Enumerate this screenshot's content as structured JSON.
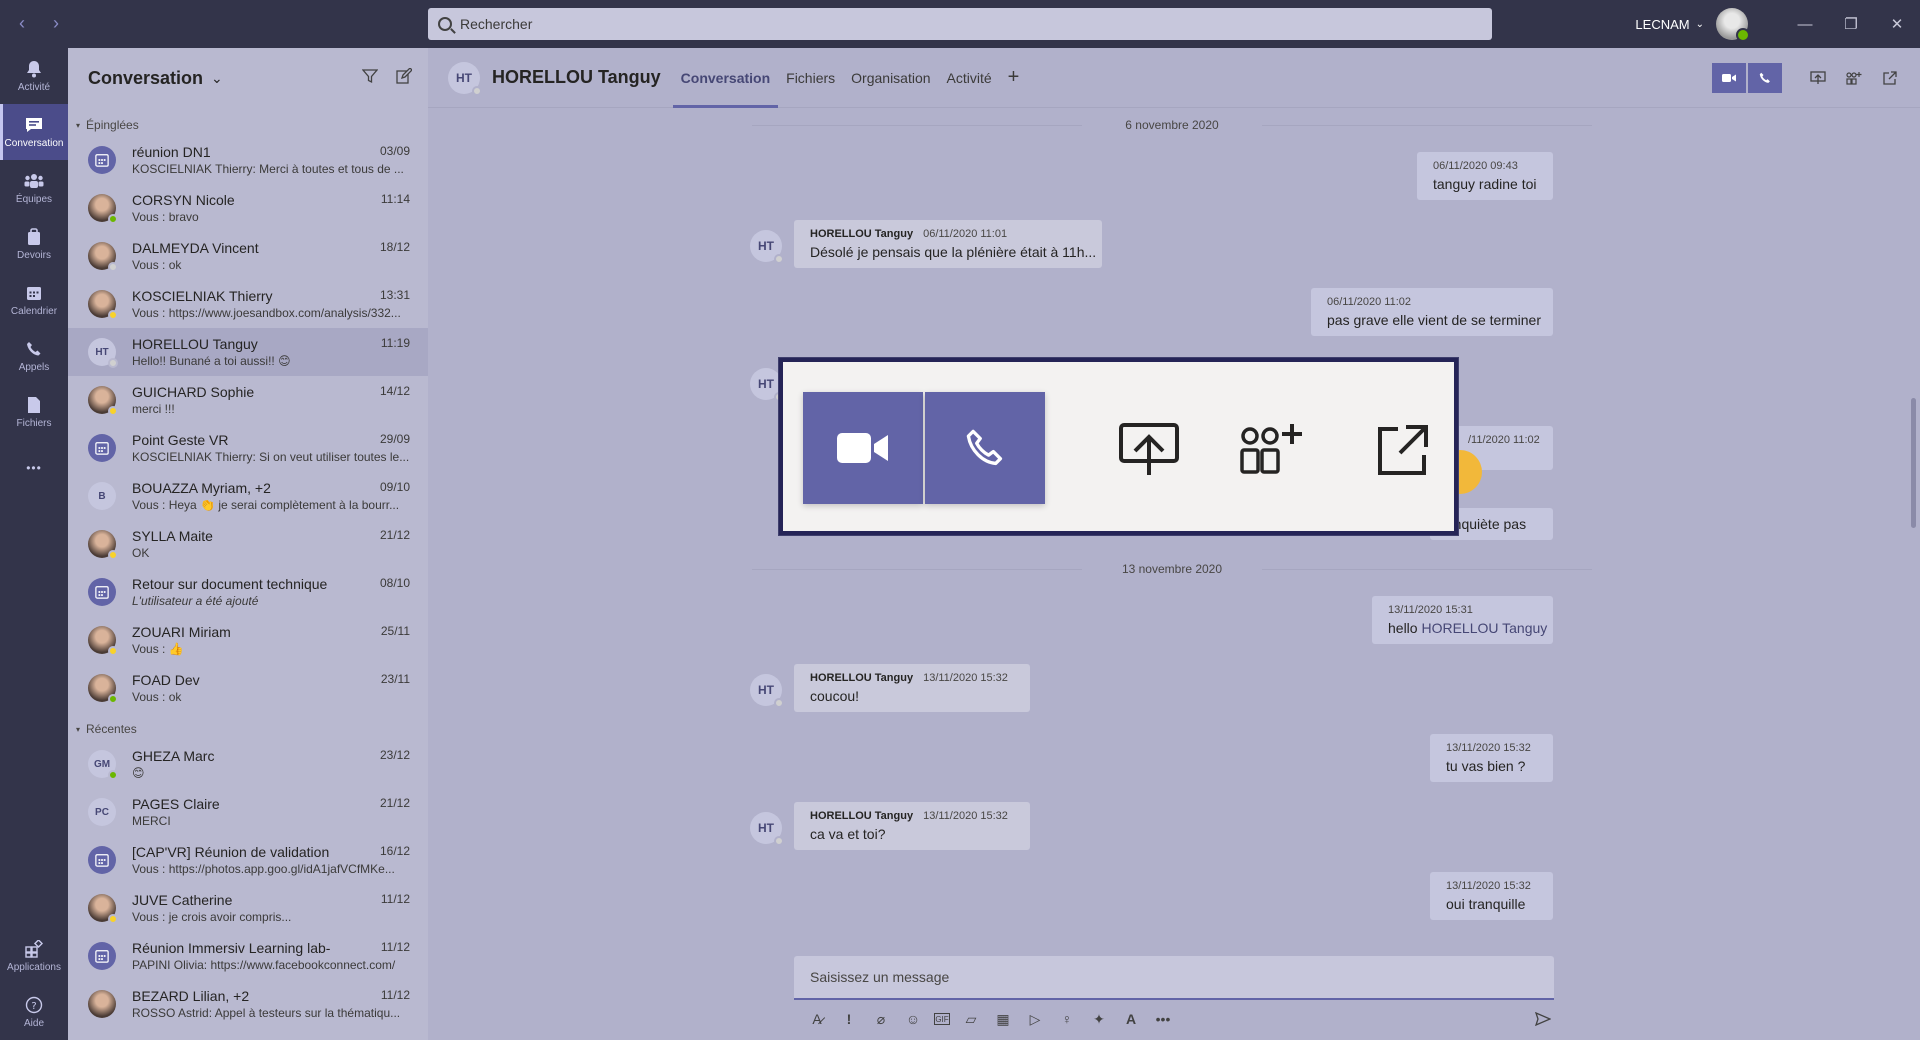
{
  "titlebar": {
    "back_icon": "chevron-left-icon",
    "forward_icon": "chevron-right-icon",
    "search_placeholder": "Rechercher",
    "tenant": "LECNAM",
    "minimize": "—",
    "restore": "❐",
    "close": "✕"
  },
  "rail": {
    "items": [
      {
        "label": "Activité",
        "icon": "bell-icon"
      },
      {
        "label": "Conversation",
        "icon": "chat-icon"
      },
      {
        "label": "Équipes",
        "icon": "teams-icon"
      },
      {
        "label": "Devoirs",
        "icon": "assignments-icon"
      },
      {
        "label": "Calendrier",
        "icon": "calendar-icon"
      },
      {
        "label": "Appels",
        "icon": "phone-icon"
      },
      {
        "label": "Fichiers",
        "icon": "files-icon"
      },
      {
        "label": "•••",
        "icon": "more-icon"
      }
    ],
    "bottom": [
      {
        "label": "Applications",
        "icon": "apps-icon"
      },
      {
        "label": "Aide",
        "icon": "help-icon"
      }
    ]
  },
  "list": {
    "title": "Conversation",
    "pinned_label": "Épinglées",
    "recent_label": "Récentes",
    "pinned": [
      {
        "name": "réunion DN1",
        "preview": "KOSCIELNIAK Thierry: Merci à toutes et tous de ...",
        "date": "03/09",
        "avatar": "meet"
      },
      {
        "name": "CORSYN Nicole",
        "preview": "Vous : bravo",
        "date": "11:14",
        "avatar": "photo",
        "status": "green"
      },
      {
        "name": "DALMEYDA Vincent",
        "preview": "Vous : ok",
        "date": "18/12",
        "avatar": "photo",
        "status": "gray"
      },
      {
        "name": "KOSCIELNIAK Thierry",
        "preview": "Vous : https://www.joesandbox.com/analysis/332...",
        "date": "13:31",
        "avatar": "photo",
        "status": "yellow"
      },
      {
        "name": "HORELLOU Tanguy",
        "preview": "Hello!! Bunané a toi aussi!! 😊",
        "date": "11:19",
        "avatar": "init",
        "initials": "HT",
        "status": "gray",
        "selected": true
      },
      {
        "name": "GUICHARD Sophie",
        "preview": "merci !!!",
        "date": "14/12",
        "avatar": "photo",
        "status": "yellow"
      },
      {
        "name": "Point Geste VR",
        "preview": "KOSCIELNIAK Thierry: Si on veut utiliser toutes le...",
        "date": "29/09",
        "avatar": "meet"
      },
      {
        "name": "BOUAZZA Myriam, +2",
        "preview": "Vous : Heya 👏 je serai complètement à la bourr...",
        "date": "09/10",
        "avatar": "init",
        "initials": "B"
      },
      {
        "name": "SYLLA Maite",
        "preview": "OK",
        "date": "21/12",
        "avatar": "photo",
        "status": "yellow"
      },
      {
        "name": "Retour sur document technique",
        "preview": "L'utilisateur a été ajouté",
        "date": "08/10",
        "avatar": "meet",
        "italic": true
      },
      {
        "name": "ZOUARI Miriam",
        "preview": "Vous : 👍",
        "date": "25/11",
        "avatar": "photo",
        "status": "yellow"
      },
      {
        "name": "FOAD Dev",
        "preview": "Vous : ok",
        "date": "23/11",
        "avatar": "photo",
        "status": "green"
      }
    ],
    "recent": [
      {
        "name": "GHEZA Marc",
        "preview": "😊",
        "date": "23/12",
        "avatar": "init",
        "initials": "GM",
        "status": "green"
      },
      {
        "name": "PAGES Claire",
        "preview": "MERCI",
        "date": "21/12",
        "avatar": "init",
        "initials": "PC"
      },
      {
        "name": "[CAP'VR] Réunion de validation",
        "preview": "Vous : https://photos.app.goo.gl/idA1jafVCfMKe...",
        "date": "16/12",
        "avatar": "meet"
      },
      {
        "name": "JUVE Catherine",
        "preview": "Vous : je crois avoir compris...",
        "date": "11/12",
        "avatar": "photo",
        "status": "yellow"
      },
      {
        "name": "Réunion Immersiv Learning lab-",
        "preview": "PAPINI Olivia: https://www.facebookconnect.com/",
        "date": "11/12",
        "avatar": "meet"
      },
      {
        "name": "BEZARD Lilian, +2",
        "preview": "ROSSO Astrid: Appel à testeurs sur la thématiqu...",
        "date": "11/12",
        "avatar": "photo"
      }
    ]
  },
  "chat": {
    "initials": "HT",
    "name": "HORELLOU Tanguy",
    "tabs": [
      "Conversation",
      "Fichiers",
      "Organisation",
      "Activité"
    ],
    "tab_add": "+",
    "date_sep_1": "6 novembre 2020",
    "date_sep_2": "13 novembre 2020",
    "messages": {
      "m1": {
        "time": "06/11/2020 09:43",
        "text": "tanguy radine toi"
      },
      "m2": {
        "author": "HORELLOU Tanguy",
        "time": "06/11/2020 11:01",
        "text": "Désolé je pensais que la plénière était à 11h..."
      },
      "m3": {
        "time": "06/11/2020 11:02",
        "text": "pas grave elle vient de se terminer"
      },
      "m4": {
        "time": "/11/2020 11:02"
      },
      "m5": {
        "text": "t'inquiète pas"
      },
      "m6": {
        "time": "13/11/2020 15:31",
        "text_prefix": "hello ",
        "mention": "HORELLOU Tanguy"
      },
      "m7": {
        "author": "HORELLOU Tanguy",
        "time": "13/11/2020 15:32",
        "text": "coucou!"
      },
      "m8": {
        "time": "13/11/2020 15:32",
        "text": "tu vas bien ?"
      },
      "m9": {
        "author": "HORELLOU Tanguy",
        "time": "13/11/2020 15:32",
        "text": "ca va et toi?"
      },
      "m10": {
        "time": "13/11/2020 15:32",
        "text": "oui tranquille"
      }
    },
    "compose_placeholder": "Saisissez un message"
  },
  "colors": {
    "brand": "#6264a7",
    "rail": "#33344a",
    "available": "#6bb700",
    "away": "#f8d22a"
  }
}
